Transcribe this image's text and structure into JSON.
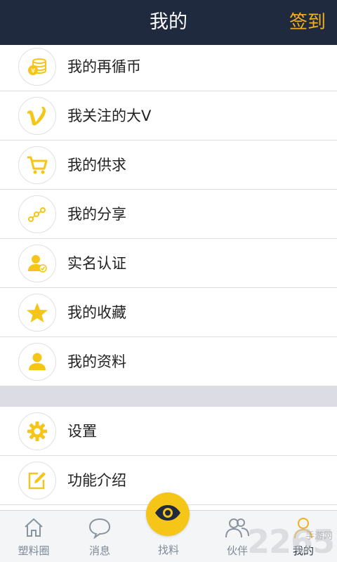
{
  "header": {
    "title": "我的",
    "signin_label": "签到"
  },
  "menu_items": [
    {
      "label": "我的再循币",
      "icon": "coin-stack-icon"
    },
    {
      "label": "我关注的大V",
      "icon": "vip-v-icon"
    },
    {
      "label": "我的供求",
      "icon": "shopping-cart-icon"
    },
    {
      "label": "我的分享",
      "icon": "share-icon"
    },
    {
      "label": "实名认证",
      "icon": "verified-user-icon"
    },
    {
      "label": "我的收藏",
      "icon": "star-icon"
    },
    {
      "label": "我的资料",
      "icon": "profile-icon"
    }
  ],
  "settings_items": [
    {
      "label": "设置",
      "icon": "gear-icon"
    },
    {
      "label": "功能介绍",
      "icon": "edit-icon"
    }
  ],
  "tabbar": {
    "tabs": [
      {
        "label": "塑料圈",
        "icon": "home-icon"
      },
      {
        "label": "消息",
        "icon": "message-icon"
      },
      {
        "label": "找料",
        "icon": "eye-icon"
      },
      {
        "label": "伙伴",
        "icon": "partners-icon"
      },
      {
        "label": "我的",
        "icon": "user-icon"
      }
    ],
    "active_index": 4
  },
  "watermark": {
    "text": "2265",
    "subtext": "手游网"
  },
  "colors": {
    "header_bg": "#1f2a3f",
    "accent": "#f2b01e",
    "icon_yellow": "#f5c518",
    "tab_inactive": "#7f8a96"
  }
}
